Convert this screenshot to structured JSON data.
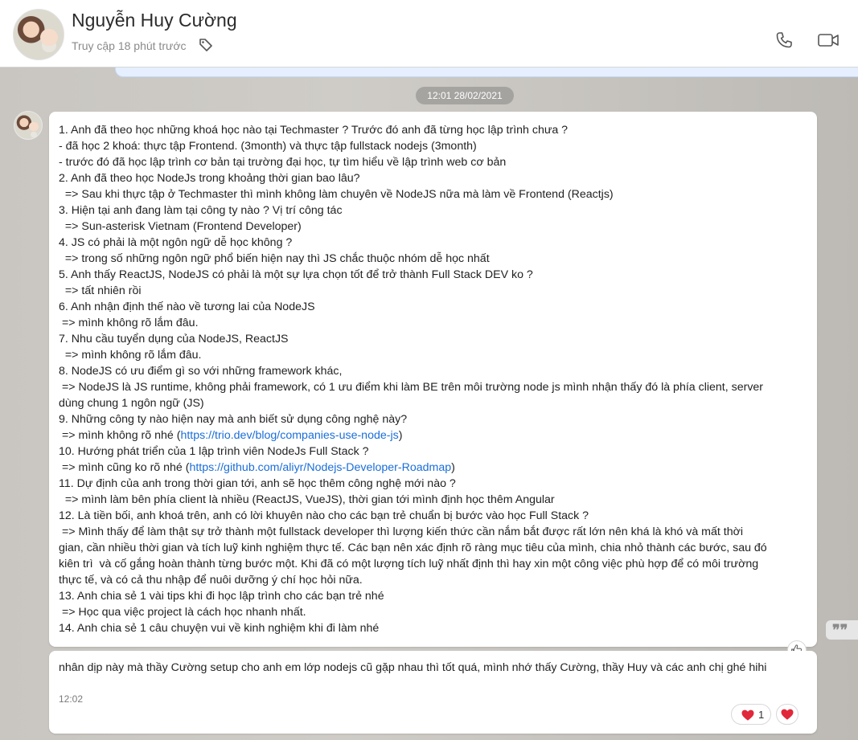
{
  "header": {
    "name": "Nguyễn Huy Cường",
    "status": "Truy cập 18 phút trước",
    "icons": [
      "tag-icon",
      "phone-icon",
      "video-camera-icon"
    ]
  },
  "thread": {
    "time_separator": "12:01 28/02/2021",
    "message1": {
      "lines": [
        "1. Anh đã theo học những khoá học nào tại Techmaster ? Trước đó anh đã từng học lập trình chưa ?",
        "- đã học 2 khoá: thực tập Frontend. (3month) và thực tập fullstack nodejs (3month)",
        "- trước đó đã học lập trình cơ bản tại trường đại học, tự tìm hiểu về lập trình web cơ bản",
        "2. Anh đã theo học NodeJs trong khoảng thời gian bao lâu?",
        "  => Sau khi thực tập ở Techmaster thì mình không làm chuyên về NodeJS nữa mà làm về Frontend (Reactjs)",
        "3. Hiện tại anh đang làm tại công ty nào ? Vị trí công tác",
        "  => Sun-asterisk Vietnam (Frontend Developer)",
        "4. JS có phải là một ngôn ngữ dễ học không ?",
        "  => trong số những ngôn ngữ phổ biến hiện nay thì JS chắc thuộc nhóm dễ học nhất",
        "5. Anh thấy ReactJS, NodeJS có phải là một sự lựa chọn tốt để trở thành Full Stack DEV ko ?",
        "  => tất nhiên rồi",
        "6. Anh nhận định thế nào về tương lai của NodeJS",
        " => mình không rõ lắm đâu.",
        "7. Nhu cầu tuyển dụng của NodeJS, ReactJS",
        "  => mình không rõ lắm đâu.",
        "8. NodeJS có ưu điểm gì so với những framework khác,",
        " => NodeJS là JS runtime, không phải framework, có 1 ưu điểm khi làm BE trên môi trường node js mình nhận thấy đó là phía client, server",
        "dùng chung 1 ngôn ngữ (JS)",
        "9. Những công ty nào hiện nay mà anh biết sử dụng công nghệ này?"
      ],
      "line_link1_prefix": " => mình không rõ nhé (",
      "link1": "https://trio.dev/blog/companies-use-node-js",
      "line_link1_suffix": ")",
      "line10": "10. Hướng phát triển của 1 lập trình viên NodeJs Full Stack ?",
      "line_link2_prefix": " => mình cũng ko rõ nhé (",
      "link2": "https://github.com/aliyr/Nodejs-Developer-Roadmap",
      "line_link2_suffix": ")",
      "lines_after": [
        "11. Dự định của anh trong thời gian tới, anh sẽ học thêm công nghệ mới nào ?",
        "  => mình làm bên phía client là nhiều (ReactJS, VueJS), thời gian tới mình định học thêm Angular",
        "12. Là tiền bối, anh khoá trên, anh có lời khuyên nào cho các bạn trẻ chuẩn bị bước vào học Full Stack ?",
        " => Mình thấy để làm thật sự trở thành một fullstack developer thì lượng kiến thức cần nắm bắt được rất lớn nên khá là khó và mất thời",
        "gian, cần nhiều thời gian và tích luỹ kinh nghiệm thực tế. Các bạn nên xác định rõ ràng mục tiêu của mình, chia nhỏ thành các bước, sau đó",
        "kiên trì  và cố gắng hoàn thành từng bước một. Khi đã có một lượng tích luỹ nhất định thì hay xin một công việc phù hợp để có môi trường",
        "thực tế, và có cả thu nhập để nuôi dưỡng ý chí học hỏi nữa.",
        "13. Anh chia sẻ 1 vài tips khi đi học lập trình cho các bạn trẻ nhé",
        " => Học qua việc project là cách học nhanh nhất.",
        "14. Anh chia sẻ 1 câu chuyện vui về kinh nghiệm khi đi làm nhé"
      ]
    },
    "message2": {
      "text": "nhân dịp này mà thầy Cường setup cho anh em lớp nodejs cũ gặp nhau thì tốt quá, mình nhớ thấy Cường, thầy Huy và các anh chị ghé hihi",
      "time": "12:02",
      "reaction_count": "1"
    },
    "colors": {
      "link": "#1a6ed8",
      "heart": "#e0283a"
    }
  }
}
